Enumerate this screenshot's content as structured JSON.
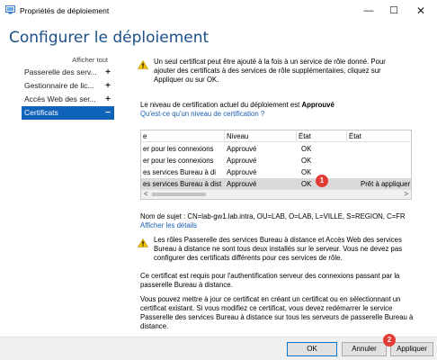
{
  "window": {
    "title": "Propriétés de déploiement",
    "minimize": "—",
    "maximize": "☐",
    "close": "✕"
  },
  "heading": "Configurer le déploiement",
  "sidebar": {
    "show_all": "Afficher tout",
    "items": [
      {
        "label": "Passerelle des serv...",
        "icon": "+",
        "active": false
      },
      {
        "label": "Gestionnaire de lic...",
        "icon": "+",
        "active": false
      },
      {
        "label": "Accès Web des ser...",
        "icon": "+",
        "active": false
      },
      {
        "label": "Certificats",
        "icon": "−",
        "active": true
      }
    ]
  },
  "content": {
    "warning_top": "Un seul certificat peut être ajouté à la fois à un service de rôle donné. Pour ajouter des certificats à des services de rôle supplémentaires, cliquez sur Appliquer ou sur OK.",
    "level_text": "Le niveau de certification actuel du déploiement est ",
    "level_value": "Approuvé",
    "level_link": "Qu'est-ce qu'un niveau de certification ?",
    "table": {
      "headers": [
        "e",
        "Niveau",
        "État",
        "État"
      ],
      "rows": [
        {
          "service": "er pour les connexions",
          "niveau": "Approuvé",
          "etat": "OK",
          "etat2": ""
        },
        {
          "service": "er pour les connexions",
          "niveau": "Approuvé",
          "etat": "OK",
          "etat2": ""
        },
        {
          "service": "es services Bureau à di",
          "niveau": "Approuvé",
          "etat": "OK",
          "etat2": ""
        },
        {
          "service": "es services Bureau à dist",
          "niveau": "Approuvé",
          "etat": "OK",
          "etat2": "Prêt à appliquer"
        }
      ],
      "scroll_left": "<",
      "scroll_right": ">"
    },
    "subject": "Nom de sujet : CN=lab-gw1.lab.intra, OU=LAB, O=LAB, L=VILLE, S=REGION, C=FR",
    "details_link": "Afficher les détails",
    "warning_bottom": "Les rôles Passerelle des services Bureau à distance et Accès Web des services Bureau à distance ne sont tous deux installés sur le serveur. Vous ne devez pas configurer des certificats différents pour ces services de rôle.",
    "para1": "Ce certificat est requis pour l'authentification serveur des connexions passant par la passerelle Bureau à distance.",
    "para2": "Vous pouvez mettre à jour ce certificat en créant un certificat ou en sélectionnant un certificat existant. Si vous modifiez ce certificat, vous devez redémarrer le service Passerelle des services Bureau à distance sur tous les serveurs de passerelle Bureau à distance."
  },
  "badges": [
    "1",
    "2"
  ],
  "buttons": {
    "ok": "OK",
    "cancel": "Annuler",
    "apply": "Appliquer"
  },
  "colors": {
    "accent": "#0f63b8",
    "heading": "#1a4f8a",
    "badge": "#e23b34",
    "warning": "#f5c400"
  }
}
